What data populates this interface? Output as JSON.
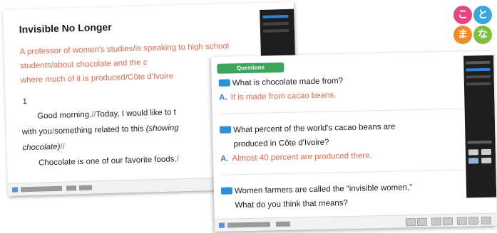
{
  "back_slide": {
    "title": "Invisible No Longer",
    "lead_parts": [
      "A professor of women's studies",
      "is speaking to high school students",
      "about chocolate and the c",
      "where much of it is produced",
      "Côte d'Ivoire"
    ],
    "paragraph_number": "1",
    "body": {
      "line1": "Good morning.",
      "line1b": "Today, I would like to t",
      "line2a": "with you",
      "line2b": "something related to this ",
      "line2c": "(showing",
      "line3": "chocolate)",
      "line4": "Chocolate is one of our favorite foods."
    },
    "slash": "/",
    "double_slash": "//"
  },
  "front_slide": {
    "badge": "Questions",
    "answer_label": "A.",
    "questions": [
      {
        "line1": "What is chocolate made from?",
        "line2": "",
        "answer": "It is made from cacao beans."
      },
      {
        "line1": "What percent of the world's cacao beans are",
        "line2": "produced in Côte d'Ivoire?",
        "answer": "Almost 40 percent are produced there."
      },
      {
        "line1": "Women farmers are called the “invisible women.”",
        "line2": "What do you think that means?",
        "answer": ""
      }
    ]
  },
  "logo": {
    "chars": [
      "こ",
      "と",
      "ま",
      "な"
    ],
    "colors": [
      "#e8457f",
      "#3aa7d9",
      "#f08b2a",
      "#7fbf3f"
    ]
  },
  "colors": {
    "lead_orange": "#e8694c",
    "slash_blue": "#3c7fd0",
    "badge_green": "#3aa55b",
    "panel_dark": "#1e1e1e"
  }
}
